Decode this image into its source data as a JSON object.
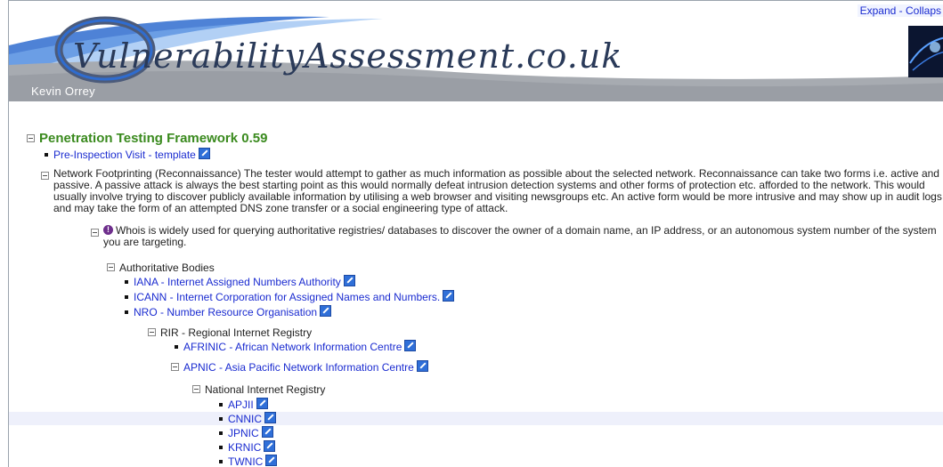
{
  "header": {
    "expand_collapse": "Expand - Collaps",
    "site_title": "VulnerabilityAssessment.co.uk",
    "author": "Kevin Orrey"
  },
  "tree": {
    "root_title": "Penetration Testing Framework 0.59",
    "pre_inspection": "Pre-Inspection Visit - template",
    "footprinting": "Network Footprinting (Reconnaissance) The tester would attempt to gather as much information as possible about the selected network. Reconnaissance can take two forms i.e. active and passive. A passive attack is always the best starting point as this would normally defeat intrusion detection systems and other forms of protection etc. afforded to the network. This would usually involve trying to discover publicly available information by utilising a web browser and visiting newsgroups etc. An active form would be more intrusive and may show up in audit logs and may take the form of an attempted DNS zone transfer or a social engineering type of attack.",
    "whois": "Whois is widely used for querying authoritative registries/ databases to discover the owner of a domain name, an IP address, or an autonomous system number of the system you are targeting.",
    "authoritative_bodies": "Authoritative Bodies",
    "iana": "IANA - Internet Assigned Numbers Authority",
    "icann": "ICANN - Internet Corporation for Assigned Names and Numbers.",
    "nro": "NRO - Number Resource Organisation",
    "rir": "RIR - Regional Internet Registry",
    "afrinic": "AFRINIC - African Network Information Centre",
    "apnic": "APNIC - Asia Pacific Network Information Centre",
    "nir": "National Internet Registry",
    "apjii": "APJII",
    "cnnic": "CNNIC",
    "jpnic": "JPNIC",
    "krnic": "KRNIC",
    "twnic": "TWNIC"
  },
  "colors": {
    "title_green": "#3a8a1e",
    "link_blue": "#1a2bd0",
    "banner_gray": "#a7abb1"
  }
}
